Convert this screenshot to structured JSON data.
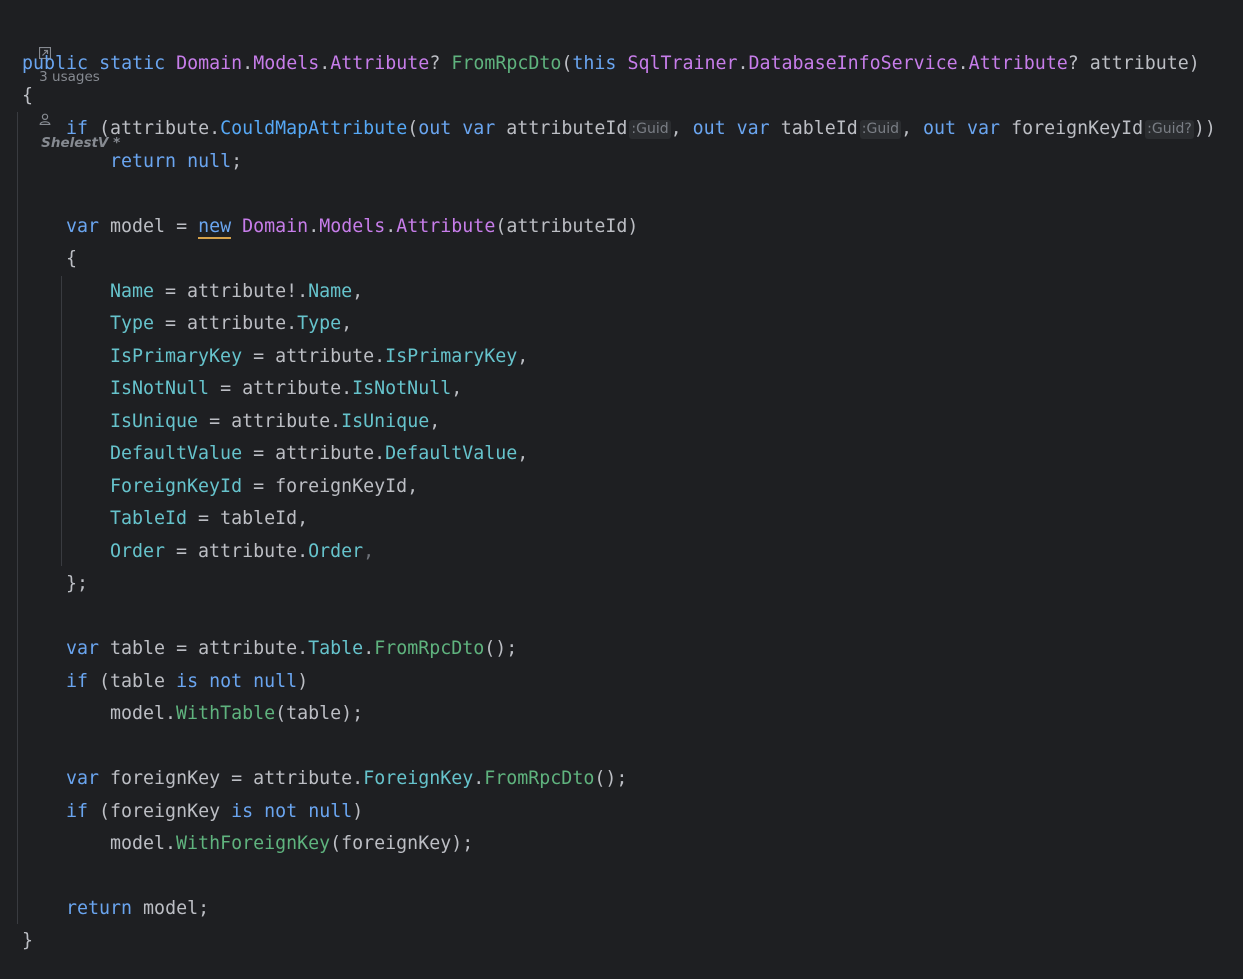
{
  "meta": {
    "usages": "3 usages",
    "author": "ShelestV *"
  },
  "colors": {
    "background": "#1e1f22",
    "keyword": "#6aa5f0",
    "type": "#c77dea",
    "method": "#56a8f5",
    "extension_method": "#5fb37e",
    "property": "#66c3cc",
    "text": "#bcbec4"
  },
  "code": {
    "l1": {
      "public": "public",
      "static": "static",
      "ns1": "Domain",
      "dot1": ".",
      "ns2": "Models",
      "dot2": ".",
      "type": "Attribute",
      "q": "? ",
      "method": "FromRpcDto",
      "paren": "(",
      "this": "this",
      "sp": " ",
      "ns3": "SqlTrainer",
      "dot3": ".",
      "ns4": "DatabaseInfoService",
      "dot4": ".",
      "type2": "Attribute",
      "tail": "? attribute)"
    },
    "l2": "{",
    "l3": {
      "if": "if",
      "open": " (attribute.",
      "call": "CouldMapAttribute",
      "p": "(",
      "out1": "out",
      "var1": "var",
      "id1": " attributeId",
      "h1": ":Guid",
      "c1": ", ",
      "out2": "out",
      "var2": "var",
      "id2": " tableId",
      "h2": ":Guid",
      "c2": ", ",
      "out3": "out",
      "var3": "var",
      "id3": " foreignKeyId",
      "h3": ":Guid?",
      "close": "))"
    },
    "l4": {
      "return": "return",
      "null": "null",
      "semi": ";"
    },
    "l5": {
      "var": "var",
      "mid": " model = ",
      "new": "new",
      "sp": " ",
      "ns1": "Domain",
      "dot1": ".",
      "ns2": "Models",
      "dot2": ".",
      "type": "Attribute",
      "tail": "(attributeId)"
    },
    "l6": "{",
    "assign": [
      {
        "prop": "Name",
        "eq": " = attribute!.",
        "src": "Name",
        "end": ","
      },
      {
        "prop": "Type",
        "eq": " = attribute.",
        "src": "Type",
        "end": ","
      },
      {
        "prop": "IsPrimaryKey",
        "eq": " = attribute.",
        "src": "IsPrimaryKey",
        "end": ","
      },
      {
        "prop": "IsNotNull",
        "eq": " = attribute.",
        "src": "IsNotNull",
        "end": ","
      },
      {
        "prop": "IsUnique",
        "eq": " = attribute.",
        "src": "IsUnique",
        "end": ","
      },
      {
        "prop": "DefaultValue",
        "eq": " = attribute.",
        "src": "DefaultValue",
        "end": ","
      },
      {
        "prop": "ForeignKeyId",
        "eq": " = foreignKeyId",
        "src": "",
        "end": ","
      },
      {
        "prop": "TableId",
        "eq": " = tableId",
        "src": "",
        "end": ","
      },
      {
        "prop": "Order",
        "eq": " = attribute.",
        "src": "Order",
        "end": ","
      }
    ],
    "l16": "};",
    "l18": {
      "var": "var",
      "mid": " table = attribute.",
      "prop": "Table",
      "dot": ".",
      "call": "FromRpcDto",
      "end": "();"
    },
    "l19": {
      "if": "if",
      "a": " (table ",
      "is": "is",
      "not": "not",
      "null": "null",
      "end": ")"
    },
    "l20": {
      "a": "model.",
      "call": "WithTable",
      "end": "(table);"
    },
    "l22": {
      "var": "var",
      "mid": " foreignKey = attribute.",
      "prop": "ForeignKey",
      "dot": ".",
      "call": "FromRpcDto",
      "end": "();"
    },
    "l23": {
      "if": "if",
      "a": " (foreignKey ",
      "is": "is",
      "not": "not",
      "null": "null",
      "end": ")"
    },
    "l24": {
      "a": "model.",
      "call": "WithForeignKey",
      "end": "(foreignKey);"
    },
    "l26": {
      "return": "return",
      "end": " model;"
    },
    "l27": "}"
  }
}
